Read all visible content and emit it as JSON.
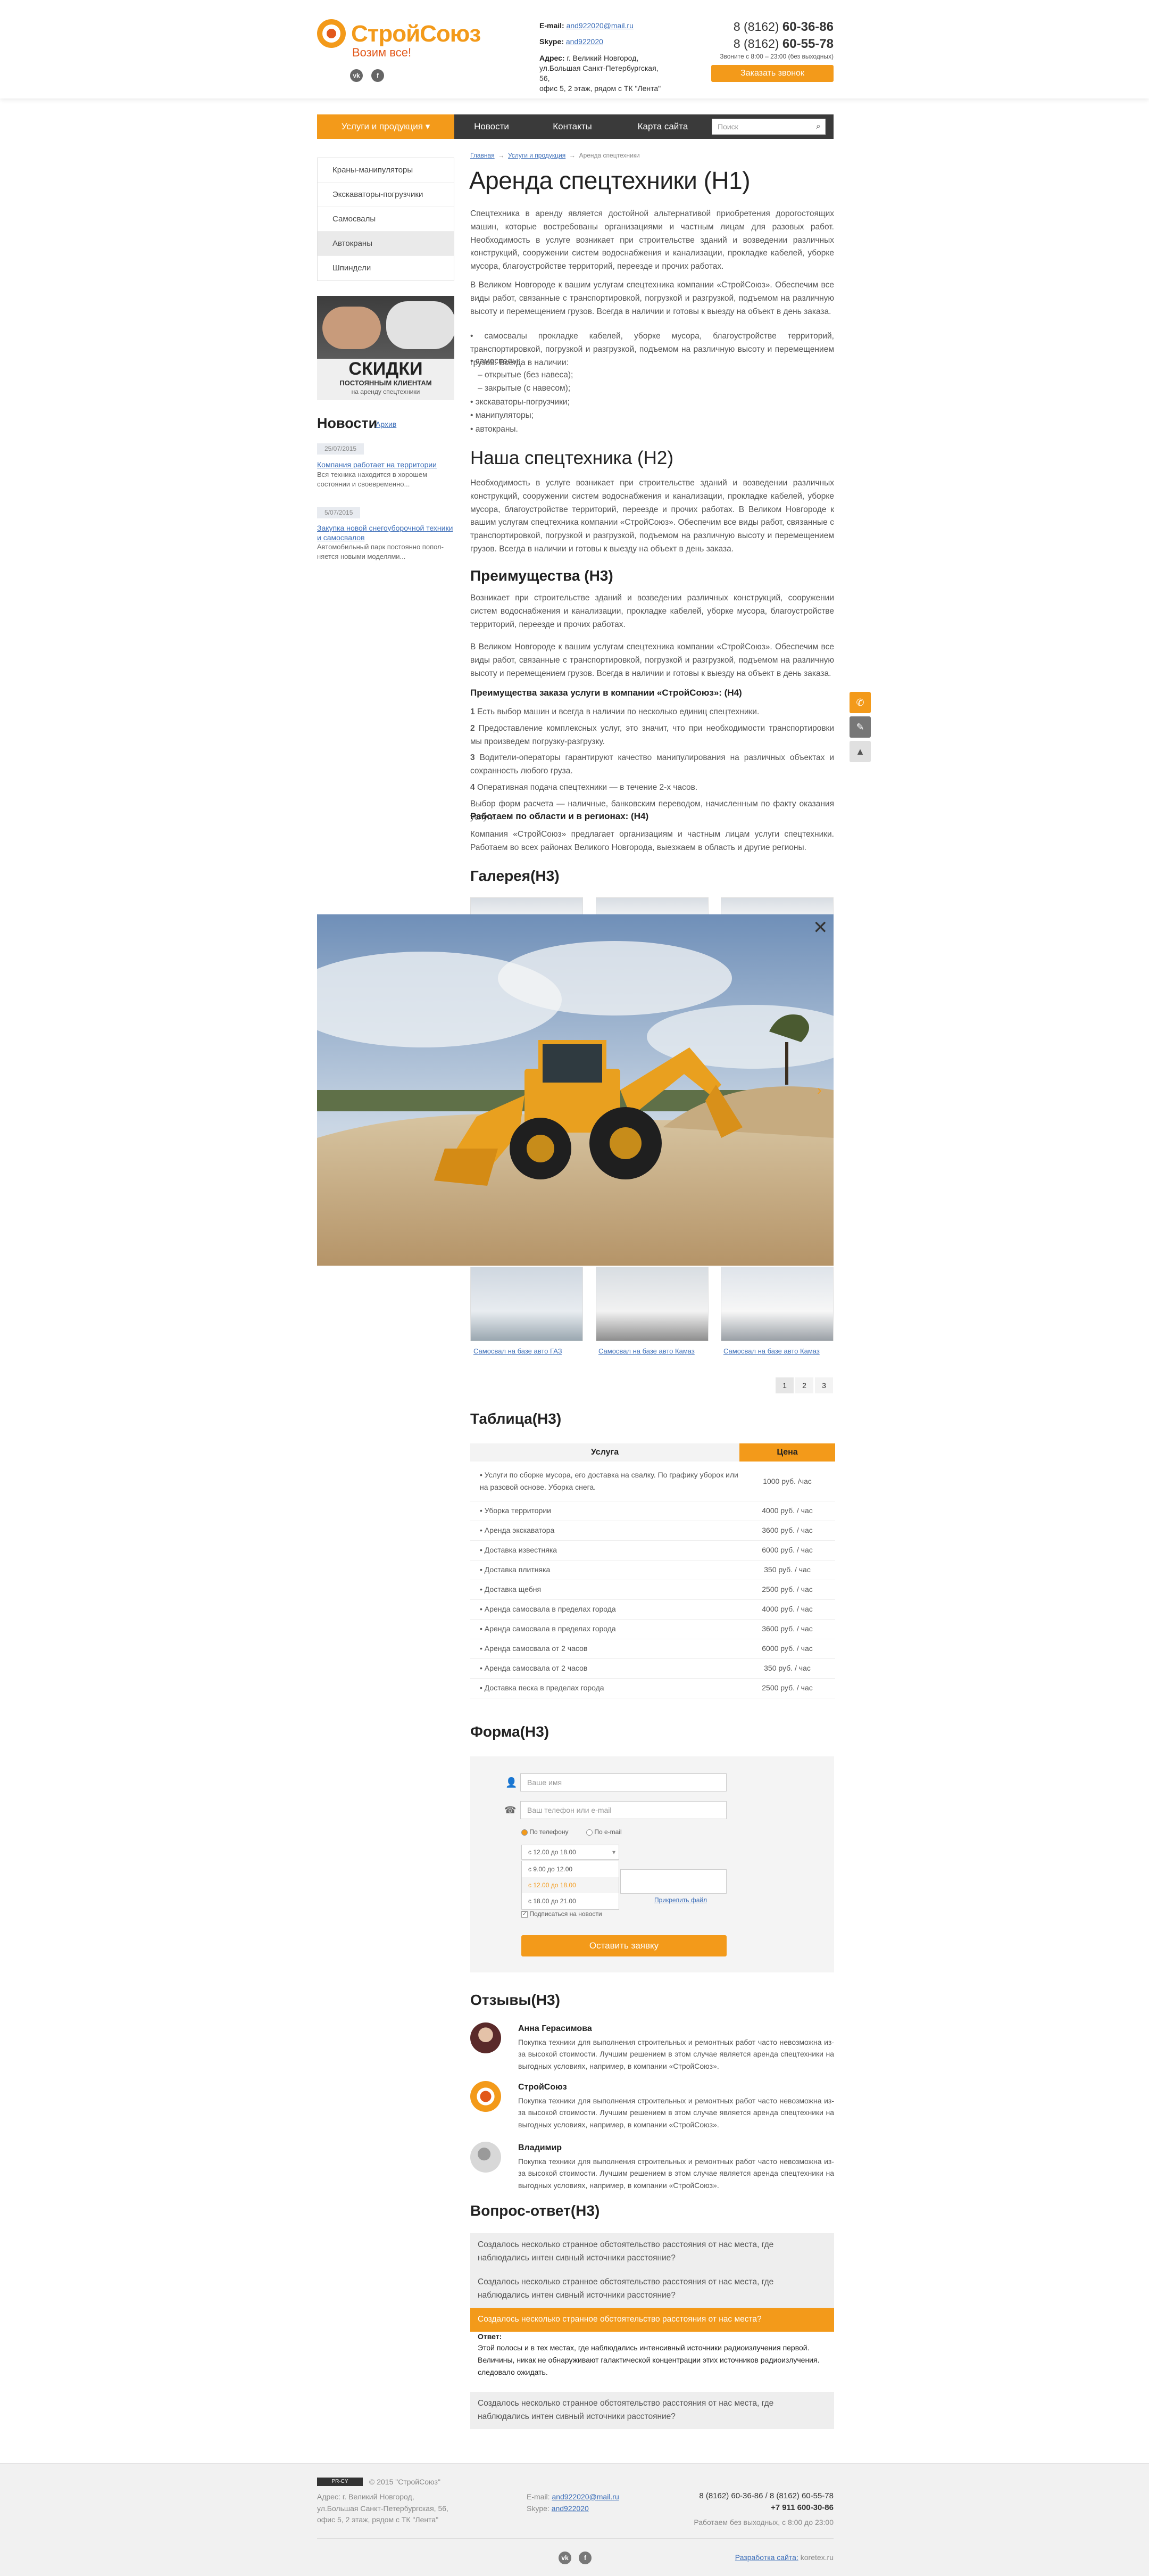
{
  "header": {
    "brand": "СтройСоюз",
    "slogan": "Возим все!",
    "email_label": "E-mail:",
    "email": "and922020@mail.ru",
    "skype_label": "Skype:",
    "skype": "and922020",
    "address_label": "Адрес:",
    "address_lines": [
      "г. Великий Новгород,",
      "ул.Большая Санкт-Петербургская, 56,",
      "офис 5, 2 этаж, рядом с ТК \"Лента\""
    ],
    "phone1_prefix": "8 (8162)",
    "phone1": "60-36-86",
    "phone2_prefix": "8 (8162)",
    "phone2": "60-55-78",
    "hours": "Звоните с 8:00 – 23:00 (без выходных)",
    "callback_button": "Заказать звонок",
    "social": [
      "vk",
      "fb"
    ]
  },
  "nav": {
    "items": [
      "Услуги и продукция",
      "Новости",
      "Контакты",
      "Карта сайта"
    ],
    "search_placeholder": "Поиск"
  },
  "sidebar": {
    "menu": [
      "Краны-манипуляторы",
      "Экскаваторы-погрузчики",
      "Самосвалы",
      "Автокраны",
      "Шпиндели"
    ],
    "active_index": 3,
    "banner_title": "СКИДКИ",
    "banner_sub1": "ПОСТОЯННЫМ КЛИЕНТАМ",
    "banner_sub2": "на аренду спецтехники",
    "news_title": "Новости",
    "news_archive": "Архив",
    "news": [
      {
        "date": "25/07/2015",
        "title": "Компания работает на территории",
        "text": "Вся техника находится в хорошем состоянии и своевременно..."
      },
      {
        "date": "5/07/2015",
        "title": "Закупка новой снегоуборочной техники и самосвалов",
        "text": "Автомобильный парк постоянно попол-няется новыми моделями..."
      }
    ]
  },
  "breadcrumb": [
    "Главная",
    "Услуги и продукция",
    "Аренда спецтехники"
  ],
  "content": {
    "h1": "Аренда спецтехники (H1)",
    "p1": "Спецтехника в аренду является достойной альтернативой приобретения дорогостоящих машин, которые востребованы организациями и частным лицам для разовых работ. Необходимость в услуге возникает при строительстве зданий и возведении различных конструкций, сооружении систем водоснабжения и канализации, прокладке кабелей, уборке мусора, благоустройстве территорий, переезде и прочих работах.",
    "p2": "В Великом Новгороде к вашим услугам спецтехника компании «СтройСоюз». Обеспечим все виды работ, связанные с транспортировкой, погрузкой и разгрузкой, подъемом на различную высоту и перемещением грузов. Всегда в наличии и готовы к выезду на объект в день заказа.",
    "p3": "• самосвалы прокладке кабелей, уборке мусора, благоустройстве территорий, транспортировкой, погрузкой и разгрузкой, подъемом на различную высоту и перемещением грузов. Всегда в наличии:",
    "list": [
      {
        "t": "самосвалы;",
        "sub": false
      },
      {
        "t": "открытые (без навеса);",
        "sub": true
      },
      {
        "t": "закрытые (с навесом);",
        "sub": true
      },
      {
        "t": "экскаваторы-погрузчики;",
        "sub": false
      },
      {
        "t": "манипуляторы;",
        "sub": false
      },
      {
        "t": "автокраны.",
        "sub": false
      }
    ],
    "h2": "Наша спецтехника (H2)",
    "p4": "Необходимость в услуге возникает при строительстве зданий и возведении различных конструкций, сооружении систем водоснабжения и канализации, прокладке кабелей, уборке мусора, благоустройстве территорий, переезде и прочих работах. В Великом Новгороде к вашим услугам спецтехника компании «СтройСоюз». Обеспечим все виды работ, связанные с транспортировкой, погрузкой и разгрузкой, подъемом на различную высоту и перемещением грузов. Всегда в наличии и готовы к выезду на объект в день заказа.",
    "h3a": "Преимущества (H3)",
    "p5": "Возникает при строительстве зданий и возведении различных конструкций, сооружении систем водоснабжения и канализации, прокладке кабелей, уборке мусора, благоустройстве территорий, переезде и прочих работах.",
    "p6": "В Великом Новгороде к вашим услугам спецтехника компании «СтройСоюз». Обеспечим все виды работ, связанные с транспортировкой, погрузкой и разгрузкой, подъемом на различную высоту и перемещением грузов. Всегда в наличии и готовы к выезду на объект в день заказа.",
    "h4a": "Преимущества заказа услуги в компании «СтройСоюз»: (H4)",
    "adv": [
      {
        "n": "1",
        "t": "Есть выбор машин и всегда в наличии по несколько единиц спецтехники."
      },
      {
        "n": "2",
        "t": "Предоставление комплексных услуг, это значит, что при необходимости транспортировки мы произведем погрузку-разгрузку."
      },
      {
        "n": "3",
        "t": "Водители-операторы гарантируют качество манипулирования на различных объектах и сохранность любого груза."
      },
      {
        "n": "4",
        "t": "Оперативная подача спецтехники — в течение 2-х часов."
      }
    ],
    "pay": "Выбор форм расчета — наличные, банковским переводом, начисленным по факту оказания услуги.",
    "h4b": "Работаем по области и в регионах: (H4)",
    "p7": "Компания «СтройСоюз» предлагает организациям и частным лицам услуги спецтехники. Работаем во всех районах Великого Новгорода, выезжаем в область и другие регионы.",
    "h3_gallery": "Галерея(H3)",
    "gallery_captions": [
      "Самосвал на базе авто ГАЗ",
      "Самосвал на базе авто Камаз",
      "Самосвал на базе авто Камаз"
    ],
    "pages": [
      "1",
      "2",
      "3"
    ],
    "h3_table": "Таблица(H3)",
    "table_headers": [
      "Услуга",
      "Цена"
    ],
    "table_rows": [
      {
        "s": "Услуги по сборке мусора, его доставка на свалку. По графику уборок или на разовой основе. Уборка снега.",
        "p": "1000 руб. /час"
      },
      {
        "s": "Уборка территории",
        "p": "4000 руб. / час"
      },
      {
        "s": "Аренда экскаватора",
        "p": "3600 руб. / час"
      },
      {
        "s": "Доставка известняка",
        "p": "6000 руб. / час"
      },
      {
        "s": "Доставка плитняка",
        "p": "350 руб. / час"
      },
      {
        "s": "Доставка щебня",
        "p": "2500 руб. / час"
      },
      {
        "s": "Аренда самосвала в пределах города",
        "p": "4000 руб. / час"
      },
      {
        "s": "Аренда самосвала в пределах города",
        "p": "3600 руб. / час"
      },
      {
        "s": "Аренда самосвала от 2 часов",
        "p": "6000 руб. / час"
      },
      {
        "s": "Аренда самосвала от 2 часов",
        "p": "350 руб. / час"
      },
      {
        "s": "Доставка песка в пределах города",
        "p": "2500 руб. / час"
      }
    ],
    "h3_form": "Форма(H3)",
    "form": {
      "name_placeholder": "Ваше имя",
      "contact_placeholder": "Ваш телефон или e-mail",
      "radio1": "По телефону",
      "radio2": "По e-mail",
      "select_value": "с 12.00 до 18.00",
      "options": [
        "с 9.00 до 12.00",
        "с 12.00 до 18.00",
        "с 18.00 до 21.00"
      ],
      "attach": "Прикрепить файл",
      "subscribe": "Подписаться на новости",
      "submit": "Оставить заявку"
    },
    "h3_reviews": "Отзывы(H3)",
    "reviews": [
      {
        "name": "Анна Герасимова",
        "text": "Покупка техники для выполнения строительных и ремонтных работ часто невозможна из-за высокой стоимости. Лучшим решением в этом случае является аренда спецтехники на выгодных условиях, например, в компании «СтройСоюз»."
      },
      {
        "name": "СтройСоюз",
        "text": "Покупка техники для выполнения строительных и ремонтных работ часто невозможна из-за высокой стоимости. Лучшим решением в этом случае является аренда спецтехники на выгодных условиях, например, в компании «СтройСоюз»."
      },
      {
        "name": "Владимир",
        "text": "Покупка техники для выполнения строительных и ремонтных работ часто невозможна из-за высокой стоимости. Лучшим решением в этом случае является аренда спецтехники на выгодных условиях, например, в компании «СтройСоюз»."
      }
    ],
    "h3_faq": "Вопрос-ответ(H3)",
    "faq": [
      "Создалось несколько странное обстоятельство расстояния от нас места, где наблюдались интен сивный источники расстояние?",
      "Создалось несколько странное обстоятельство расстояния от нас места, где наблюдались интен сивный источники расстояние?",
      "Создалось несколько странное обстоятельство расстояния от нас места?",
      "Создалось несколько странное обстоятельство расстояния от нас места, где наблюдались интен сивный источники расстояние?"
    ],
    "answer_label": "Ответ:",
    "answer": "Этой полосы и в тех местах, где наблюдались интенсивный источники радиоизлучения первой. Величины, никак не обнаруживают галактической концентрации этих источников радиоизлучения. следовало ожидать."
  },
  "footer": {
    "copyright": "© 2015 \"СтройСоюз\"",
    "counter": "PR-CY",
    "address_lines": [
      "Адрес: г. Великий Новгород,",
      "ул.Большая Санкт-Петербургская, 56,",
      "офис 5, 2 этаж, рядом с ТК \"Лента\""
    ],
    "email_label": "E-mail:",
    "email": "and922020@mail.ru",
    "skype_label": "Skype:",
    "skype": "and922020",
    "phones": "8 (8162) 60-36-86 / 8 (8162) 60-55-78",
    "mobile": "+7 911 600-30-86",
    "hours": "Работаем без выходных, с 8:00 до 23:00",
    "dev_label": "Разработка сайта:",
    "dev": "koretex.ru"
  },
  "colors": {
    "accent": "#f39a1a",
    "accent_dark": "#e2581b",
    "nav": "#3a3a3a",
    "link": "#3b6db8"
  }
}
